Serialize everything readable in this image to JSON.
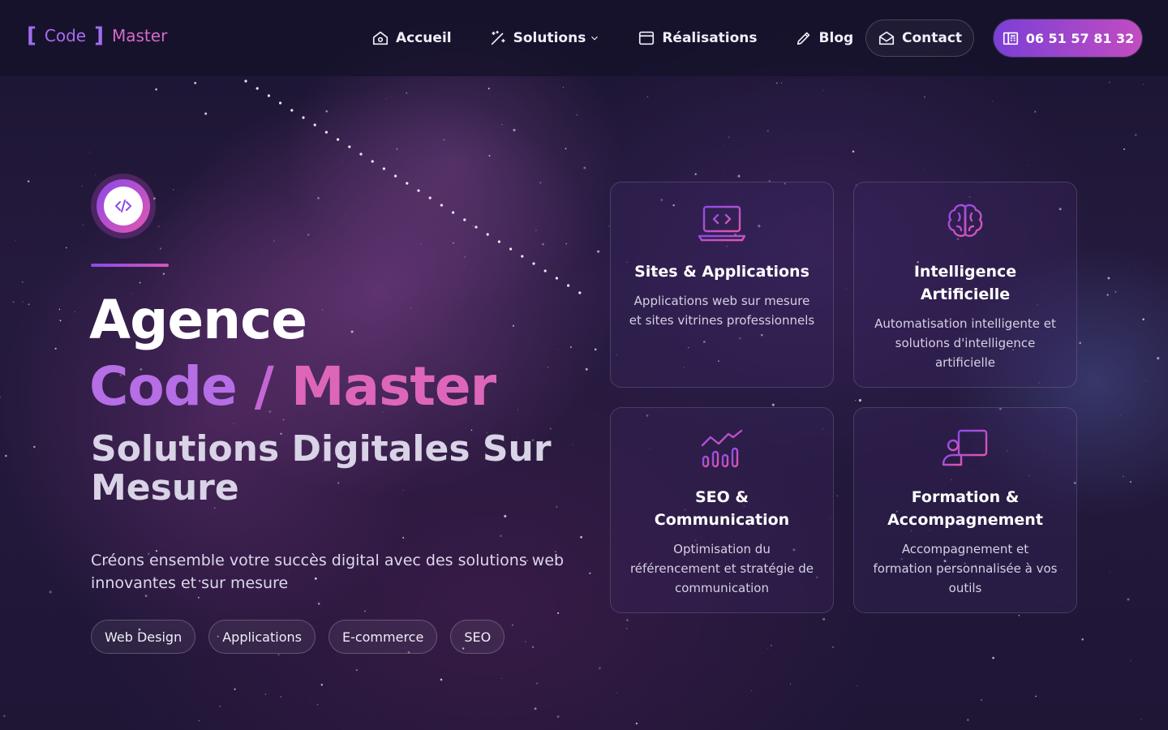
{
  "brand": {
    "bracket_open": "[",
    "word1": "Code",
    "bracket_close": "]",
    "word2": "Master"
  },
  "nav": {
    "items": [
      {
        "label": "Accueil",
        "icon": "home-icon"
      },
      {
        "label": "Solutions",
        "icon": "magic-wand-icon",
        "dropdown": true
      },
      {
        "label": "Réalisations",
        "icon": "browser-window-icon"
      },
      {
        "label": "Blog",
        "icon": "pen-icon"
      }
    ],
    "contact_label": "Contact",
    "contact_icon": "mail-open-icon",
    "phone_label": "06 51 57 81 32",
    "phone_icon": "fax-phone-icon"
  },
  "hero": {
    "icon": "code-icon",
    "title_line1": "Agence",
    "title_word1": "Code",
    "title_slash": "/",
    "title_word2": "Master",
    "subtitle": "Solutions Digitales Sur Mesure",
    "description": "Créons ensemble votre succès digital avec des solutions web innovantes et sur mesure",
    "tags": [
      "Web Design",
      "Applications",
      "E-commerce",
      "SEO"
    ]
  },
  "cards": [
    {
      "icon": "laptop-code-icon",
      "title": "Sites & Applications",
      "text": "Applications web sur mesure et sites vitrines professionnels"
    },
    {
      "icon": "brain-icon",
      "title": "Intelligence Artificielle",
      "text": "Automatisation intelligente et solutions d'intelligence artificielle"
    },
    {
      "icon": "chart-growth-icon",
      "title": "SEO & Communication",
      "text": "Optimisation du référencement et stratégie de communication"
    },
    {
      "icon": "teacher-board-icon",
      "title": "Formation & Accompagnement",
      "text": "Accompagnement et formation personnalisée à vos outils"
    }
  ],
  "colors": {
    "accent_purple": "#8a4ae8",
    "accent_pink": "#d456b8",
    "background": "#1f1636"
  }
}
